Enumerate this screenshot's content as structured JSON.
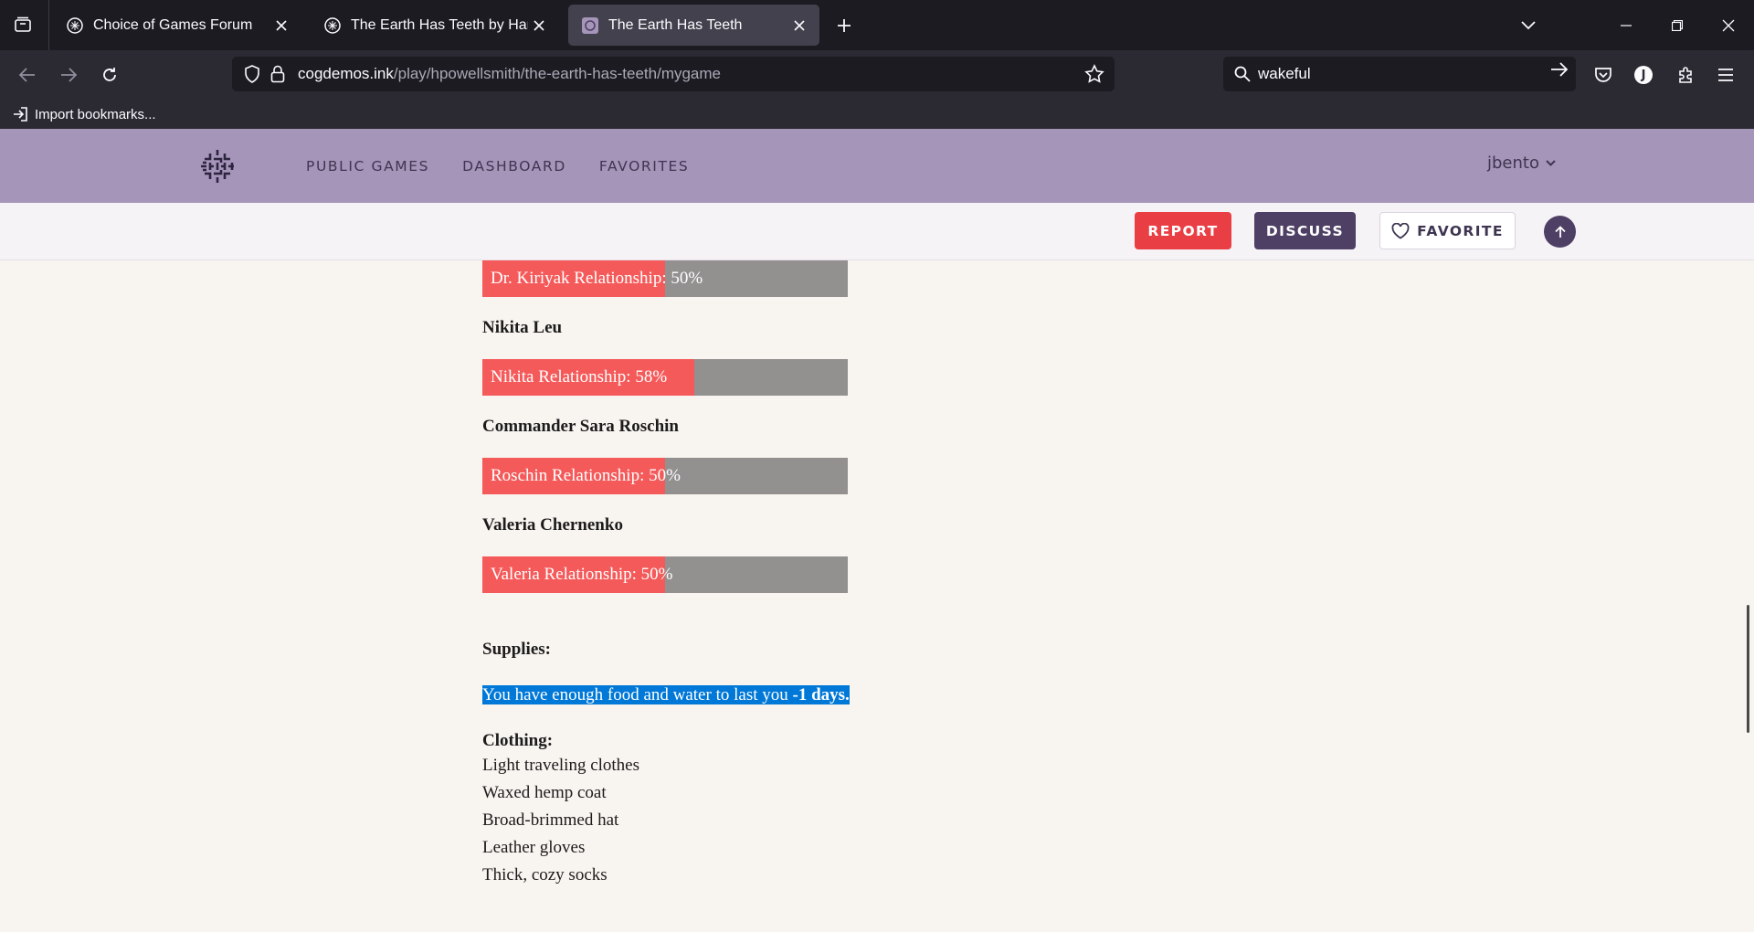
{
  "browser": {
    "tabs": [
      {
        "title": "Choice of Games Forum",
        "active": false
      },
      {
        "title": "The Earth Has Teeth by Harris Powell-Smith",
        "active": false
      },
      {
        "title": "The Earth Has Teeth",
        "active": true
      }
    ],
    "url": {
      "domain": "cogdemos.ink",
      "path": "/play/hpowellsmith/the-earth-has-teeth/mygame"
    },
    "search": {
      "value": "wakeful"
    },
    "bookmarks": [
      {
        "label": "Import bookmarks..."
      }
    ]
  },
  "site": {
    "nav": [
      {
        "label": "PUBLIC GAMES"
      },
      {
        "label": "DASHBOARD"
      },
      {
        "label": "FAVORITES"
      }
    ],
    "username": "jbento",
    "colors": {
      "header": "#a595b8",
      "report": "#ea3e45",
      "discuss": "#4e3f64"
    }
  },
  "actions": {
    "report": "REPORT",
    "discuss": "DISCUSS",
    "favorite": "FAVORITE"
  },
  "stats": {
    "bar_color": "#f55a5a",
    "relationships": [
      {
        "name": "",
        "label": "Dr. Kiriyak Relationship: 50%",
        "percent": 50
      },
      {
        "name": "Nikita Leu",
        "label": "Nikita Relationship: 58%",
        "percent": 58
      },
      {
        "name": "Commander Sara Roschin",
        "label": "Roschin Relationship: 50%",
        "percent": 50
      },
      {
        "name": "Valeria Chernenko",
        "label": "Valeria Relationship: 50%",
        "percent": 50
      }
    ],
    "supplies": {
      "heading": "Supplies:",
      "text": "You have enough food and water to last you ",
      "amount": "-1 days."
    },
    "clothing": {
      "heading": "Clothing:",
      "items": [
        "Light traveling clothes",
        "Waxed hemp coat",
        "Broad-brimmed hat",
        "Leather gloves",
        "Thick, cozy socks"
      ]
    }
  }
}
